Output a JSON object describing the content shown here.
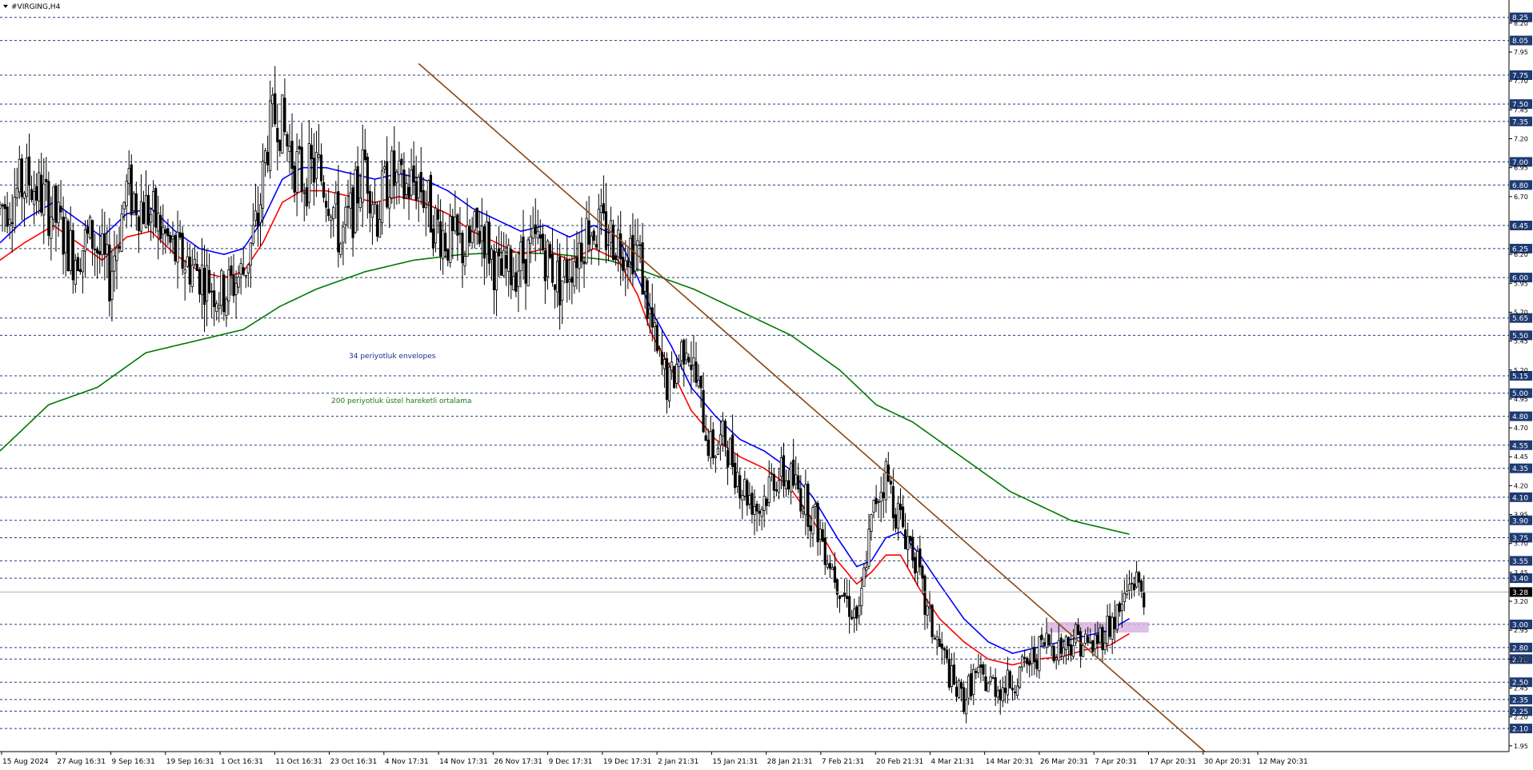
{
  "window": {
    "title": "#VIRGING,H4"
  },
  "annotations": {
    "envelopes": "34 periyotluk envelopes",
    "ema": "200 periyotluk üstel hareketli ortalama"
  },
  "colors": {
    "background": "#ffffff",
    "grid": "#1f3b73",
    "candles": "#000000",
    "env_upper": "#0000ff",
    "env_lower": "#ff0000",
    "ema200": "#007800",
    "trendline": "#8b4513",
    "zone": "#d8b4e2",
    "current_price_bg": "#000000"
  },
  "chart_data": {
    "type": "candlestick",
    "symbol": "#VIRGING",
    "timeframe": "H4",
    "ylim": [
      1.9,
      8.4
    ],
    "current_price": "3.28",
    "price_levels": [
      "8.25",
      "8.05",
      "7.75",
      "7.50",
      "7.35",
      "7.00",
      "6.80",
      "6.45",
      "6.25",
      "6.00",
      "5.65",
      "5.50",
      "5.15",
      "5.00",
      "4.80",
      "4.55",
      "4.35",
      "4.10",
      "3.90",
      "3.75",
      "3.55",
      "3.40",
      "3.00",
      "2.80",
      "2.70",
      "2.50",
      "2.35",
      "2.25",
      "2.10"
    ],
    "axis_ticks": [
      "8.20",
      "7.95",
      "7.70",
      "7.45",
      "7.20",
      "6.95",
      "6.70",
      "6.20",
      "5.95",
      "5.70",
      "5.45",
      "5.20",
      "4.95",
      "4.70",
      "4.45",
      "4.20",
      "3.95",
      "3.70",
      "3.45",
      "3.20",
      "2.95",
      "2.70",
      "2.45",
      "2.20",
      "1.95"
    ],
    "x_labels": [
      "15 Aug 2024",
      "27 Aug 16:31",
      "9 Sep 16:31",
      "19 Sep 16:31",
      "1 Oct 16:31",
      "11 Oct 16:31",
      "23 Oct 16:31",
      "4 Nov 17:31",
      "14 Nov 17:31",
      "26 Nov 17:31",
      "9 Dec 17:31",
      "19 Dec 17:31",
      "2 Jan 21:31",
      "15 Jan 21:31",
      "28 Jan 21:31",
      "7 Feb 21:31",
      "20 Feb 21:31",
      "4 Mar 21:31",
      "14 Mar 20:31",
      "26 Mar 20:31",
      "7 Apr 20:31",
      "17 Apr 20:31",
      "30 Apr 20:31",
      "12 May 20:31"
    ],
    "price_path": [
      [
        0,
        6.6
      ],
      [
        12,
        6.85
      ],
      [
        22,
        6.55
      ],
      [
        30,
        6.2
      ],
      [
        38,
        6.35
      ],
      [
        45,
        6.0
      ],
      [
        52,
        6.75
      ],
      [
        62,
        6.55
      ],
      [
        72,
        6.2
      ],
      [
        82,
        6.05
      ],
      [
        91,
        5.85
      ],
      [
        100,
        6.05
      ],
      [
        106,
        6.5
      ],
      [
        110,
        7.2
      ],
      [
        114,
        7.45
      ],
      [
        118,
        7.15
      ],
      [
        124,
        6.85
      ],
      [
        130,
        6.95
      ],
      [
        136,
        6.7
      ],
      [
        140,
        6.3
      ],
      [
        145,
        6.6
      ],
      [
        150,
        7.0
      ],
      [
        155,
        6.55
      ],
      [
        160,
        6.9
      ],
      [
        165,
        6.75
      ],
      [
        172,
        6.85
      ],
      [
        178,
        6.5
      ],
      [
        185,
        6.3
      ],
      [
        192,
        6.25
      ],
      [
        198,
        6.45
      ],
      [
        205,
        6.0
      ],
      [
        212,
        6.1
      ],
      [
        222,
        6.3
      ],
      [
        230,
        5.95
      ],
      [
        235,
        6.15
      ],
      [
        242,
        6.45
      ],
      [
        252,
        6.35
      ],
      [
        262,
        6.25
      ],
      [
        270,
        5.3
      ],
      [
        275,
        5.05
      ],
      [
        282,
        5.5
      ],
      [
        288,
        4.9
      ],
      [
        292,
        4.5
      ],
      [
        298,
        4.6
      ],
      [
        305,
        4.2
      ],
      [
        312,
        4.0
      ],
      [
        318,
        4.3
      ],
      [
        325,
        4.25
      ],
      [
        330,
        4.1
      ],
      [
        336,
        3.85
      ],
      [
        342,
        3.5
      ],
      [
        348,
        3.2
      ],
      [
        353,
        3.05
      ],
      [
        356,
        3.6
      ],
      [
        360,
        4.1
      ],
      [
        364,
        4.3
      ],
      [
        368,
        4.0
      ],
      [
        372,
        3.8
      ],
      [
        376,
        3.6
      ],
      [
        380,
        3.15
      ],
      [
        384,
        2.9
      ],
      [
        388,
        2.7
      ],
      [
        392,
        2.45
      ],
      [
        396,
        2.35
      ],
      [
        400,
        2.55
      ],
      [
        406,
        2.5
      ],
      [
        412,
        2.45
      ],
      [
        418,
        2.55
      ],
      [
        424,
        2.7
      ],
      [
        430,
        2.85
      ],
      [
        436,
        2.8
      ],
      [
        442,
        2.9
      ],
      [
        448,
        2.8
      ],
      [
        454,
        2.95
      ],
      [
        460,
        3.1
      ],
      [
        465,
        3.4
      ],
      [
        470,
        3.3
      ]
    ],
    "envelope_upper": [
      [
        0,
        6.3
      ],
      [
        10,
        6.5
      ],
      [
        22,
        6.65
      ],
      [
        32,
        6.5
      ],
      [
        42,
        6.35
      ],
      [
        52,
        6.55
      ],
      [
        62,
        6.6
      ],
      [
        72,
        6.4
      ],
      [
        82,
        6.25
      ],
      [
        92,
        6.2
      ],
      [
        100,
        6.25
      ],
      [
        108,
        6.5
      ],
      [
        116,
        6.85
      ],
      [
        124,
        6.95
      ],
      [
        134,
        6.95
      ],
      [
        144,
        6.9
      ],
      [
        154,
        6.85
      ],
      [
        164,
        6.9
      ],
      [
        174,
        6.85
      ],
      [
        184,
        6.75
      ],
      [
        194,
        6.6
      ],
      [
        204,
        6.5
      ],
      [
        214,
        6.4
      ],
      [
        224,
        6.45
      ],
      [
        234,
        6.35
      ],
      [
        244,
        6.45
      ],
      [
        254,
        6.35
      ],
      [
        262,
        6.0
      ],
      [
        268,
        5.7
      ],
      [
        276,
        5.4
      ],
      [
        284,
        5.05
      ],
      [
        294,
        4.8
      ],
      [
        304,
        4.6
      ],
      [
        314,
        4.5
      ],
      [
        324,
        4.35
      ],
      [
        334,
        4.1
      ],
      [
        344,
        3.75
      ],
      [
        352,
        3.5
      ],
      [
        358,
        3.55
      ],
      [
        364,
        3.75
      ],
      [
        370,
        3.8
      ],
      [
        378,
        3.6
      ],
      [
        386,
        3.35
      ],
      [
        396,
        3.05
      ],
      [
        406,
        2.85
      ],
      [
        416,
        2.75
      ],
      [
        426,
        2.8
      ],
      [
        436,
        2.85
      ],
      [
        446,
        2.9
      ],
      [
        456,
        2.95
      ],
      [
        464,
        3.05
      ]
    ],
    "envelope_lower": [
      [
        0,
        6.15
      ],
      [
        10,
        6.3
      ],
      [
        22,
        6.45
      ],
      [
        32,
        6.3
      ],
      [
        42,
        6.15
      ],
      [
        52,
        6.35
      ],
      [
        62,
        6.4
      ],
      [
        72,
        6.2
      ],
      [
        82,
        6.05
      ],
      [
        92,
        6.0
      ],
      [
        100,
        6.05
      ],
      [
        108,
        6.3
      ],
      [
        116,
        6.65
      ],
      [
        124,
        6.75
      ],
      [
        134,
        6.75
      ],
      [
        144,
        6.7
      ],
      [
        154,
        6.65
      ],
      [
        164,
        6.7
      ],
      [
        174,
        6.65
      ],
      [
        184,
        6.55
      ],
      [
        194,
        6.4
      ],
      [
        204,
        6.3
      ],
      [
        214,
        6.2
      ],
      [
        224,
        6.25
      ],
      [
        234,
        6.15
      ],
      [
        244,
        6.25
      ],
      [
        254,
        6.15
      ],
      [
        262,
        5.85
      ],
      [
        268,
        5.5
      ],
      [
        276,
        5.2
      ],
      [
        284,
        4.85
      ],
      [
        294,
        4.6
      ],
      [
        304,
        4.45
      ],
      [
        314,
        4.35
      ],
      [
        324,
        4.2
      ],
      [
        334,
        3.9
      ],
      [
        344,
        3.55
      ],
      [
        352,
        3.35
      ],
      [
        358,
        3.45
      ],
      [
        364,
        3.6
      ],
      [
        370,
        3.6
      ],
      [
        378,
        3.3
      ],
      [
        386,
        3.05
      ],
      [
        396,
        2.85
      ],
      [
        406,
        2.7
      ],
      [
        416,
        2.65
      ],
      [
        426,
        2.7
      ],
      [
        436,
        2.72
      ],
      [
        446,
        2.78
      ],
      [
        456,
        2.82
      ],
      [
        464,
        2.92
      ]
    ],
    "ema200": [
      [
        0,
        4.5
      ],
      [
        20,
        4.9
      ],
      [
        40,
        5.05
      ],
      [
        60,
        5.35
      ],
      [
        80,
        5.45
      ],
      [
        100,
        5.55
      ],
      [
        115,
        5.75
      ],
      [
        130,
        5.9
      ],
      [
        150,
        6.05
      ],
      [
        170,
        6.15
      ],
      [
        190,
        6.2
      ],
      [
        210,
        6.22
      ],
      [
        230,
        6.2
      ],
      [
        250,
        6.15
      ],
      [
        265,
        6.05
      ],
      [
        285,
        5.9
      ],
      [
        305,
        5.7
      ],
      [
        325,
        5.5
      ],
      [
        345,
        5.2
      ],
      [
        360,
        4.9
      ],
      [
        375,
        4.75
      ],
      [
        395,
        4.45
      ],
      [
        415,
        4.15
      ],
      [
        440,
        3.9
      ],
      [
        464,
        3.78
      ]
    ],
    "trendline": [
      [
        172,
        7.85
      ],
      [
        495,
        1.9
      ]
    ],
    "zone": {
      "x": [
        430,
        472
      ],
      "y": [
        2.93,
        3.02
      ]
    }
  }
}
